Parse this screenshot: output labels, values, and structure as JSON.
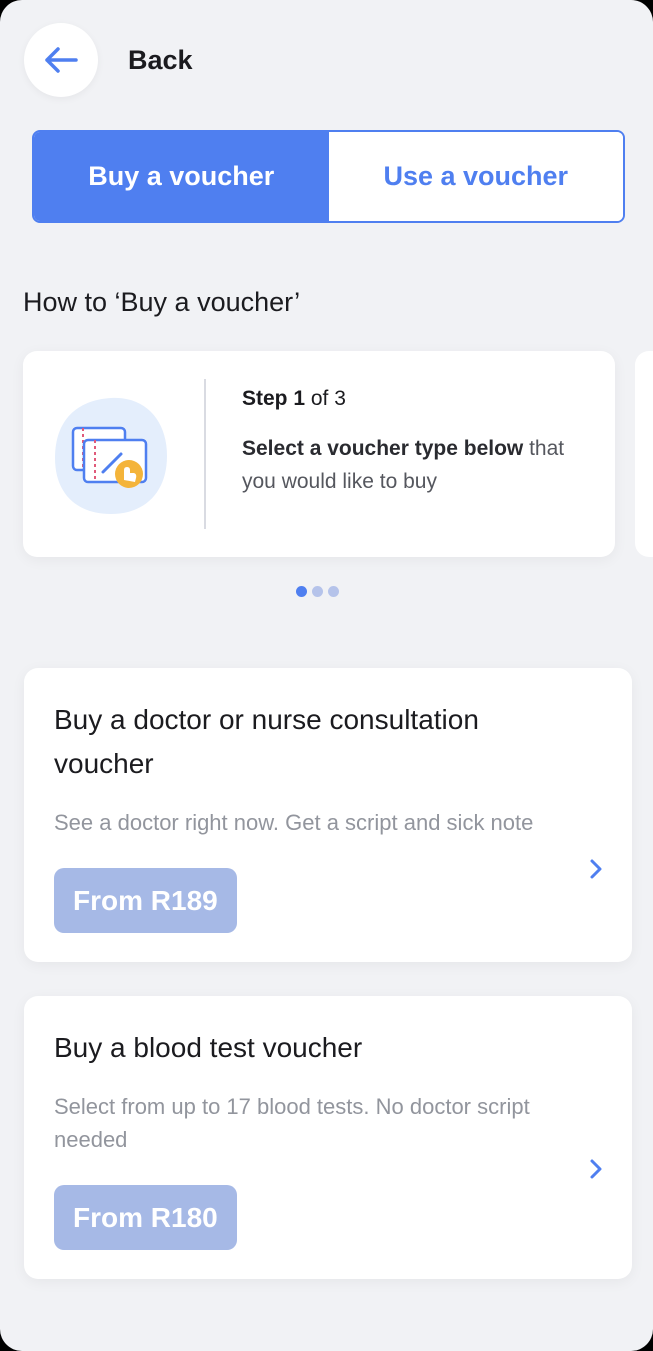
{
  "header": {
    "back_label": "Back"
  },
  "tabs": [
    {
      "label": "Buy a voucher",
      "active": true
    },
    {
      "label": "Use a voucher",
      "active": false
    }
  ],
  "how_to": {
    "title": "How to ‘Buy a voucher’",
    "step": {
      "step_word": "Step 1",
      "of_text": " of 3",
      "text_bold": "Select a voucher type below",
      "text_rest": " that you would like to buy"
    },
    "carousel_pages": 3,
    "carousel_active": 0
  },
  "offers": [
    {
      "title": "Buy a doctor or nurse consultation voucher",
      "description": "See a doctor right now. Get a script and sick note",
      "price": "From R189"
    },
    {
      "title": "Buy a blood test voucher",
      "description": "Select from up to 17 blood tests. No doctor script needed",
      "price": "From R180"
    }
  ],
  "colors": {
    "accent": "#4f7ff0",
    "background": "#f1f2f5",
    "price_pill": "#a6b9e6",
    "illustration_accent": "#f4b43a"
  },
  "icons": {
    "back": "arrow-left-icon",
    "chevron": "chevron-right-icon",
    "step_illustration": "voucher-select-illustration"
  }
}
